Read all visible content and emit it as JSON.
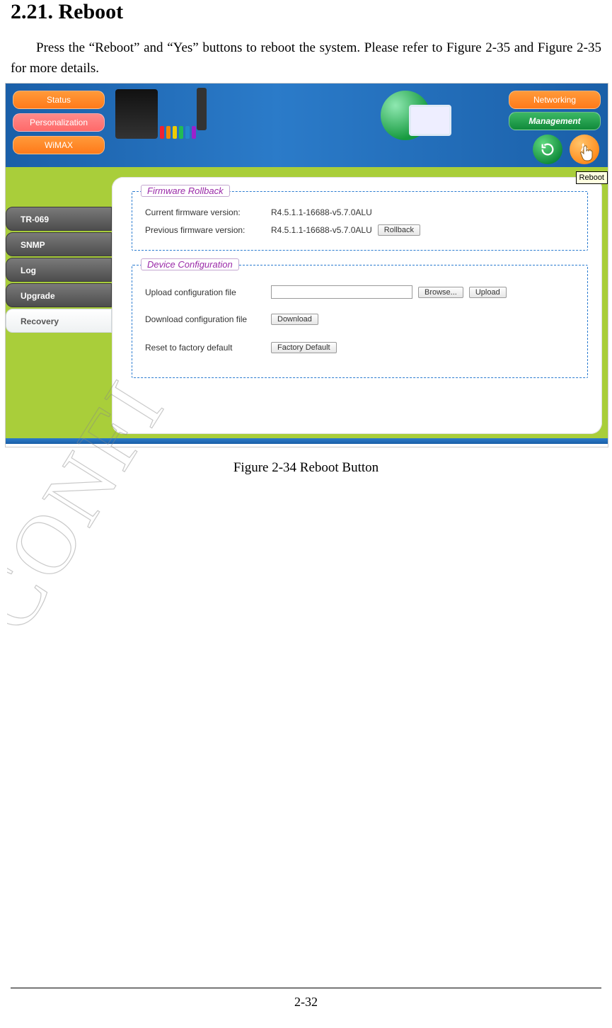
{
  "heading": "2.21.  Reboot",
  "paragraph": "Press the “Reboot” and “Yes” buttons to reboot the system. Please refer to Figure 2-35 and Figure 2-35 for more details.",
  "screenshot": {
    "left_nav": {
      "status": "Status",
      "personalization": "Personalization",
      "wimax": "WiMAX"
    },
    "right_nav": {
      "networking": "Networking",
      "management": "Management"
    },
    "tooltip": "Reboot",
    "side_tabs": {
      "tr069": "TR-069",
      "snmp": "SNMP",
      "log": "Log",
      "upgrade": "Upgrade",
      "recovery": "Recovery"
    },
    "firmware_rollback": {
      "legend": "Firmware Rollback",
      "current_label": "Current firmware version:",
      "current_value": "R4.5.1.1-16688-v5.7.0ALU",
      "previous_label": "Previous firmware version:",
      "previous_value": "R4.5.1.1-16688-v5.7.0ALU",
      "rollback_btn": "Rollback"
    },
    "device_config": {
      "legend": "Device Configuration",
      "upload_label": "Upload configuration file",
      "browse_btn": "Browse...",
      "upload_btn": "Upload",
      "download_label": "Download configuration file",
      "download_btn": "Download",
      "reset_label": "Reset to factory default",
      "factory_btn": "Factory Default"
    },
    "led_colors": [
      "#e23",
      "#e80",
      "#ec0",
      "#2b5",
      "#28c",
      "#92c"
    ]
  },
  "figure_caption": "Figure 2-34    Reboot Button",
  "watermark_text": "CONFI",
  "page_number": "2-32"
}
